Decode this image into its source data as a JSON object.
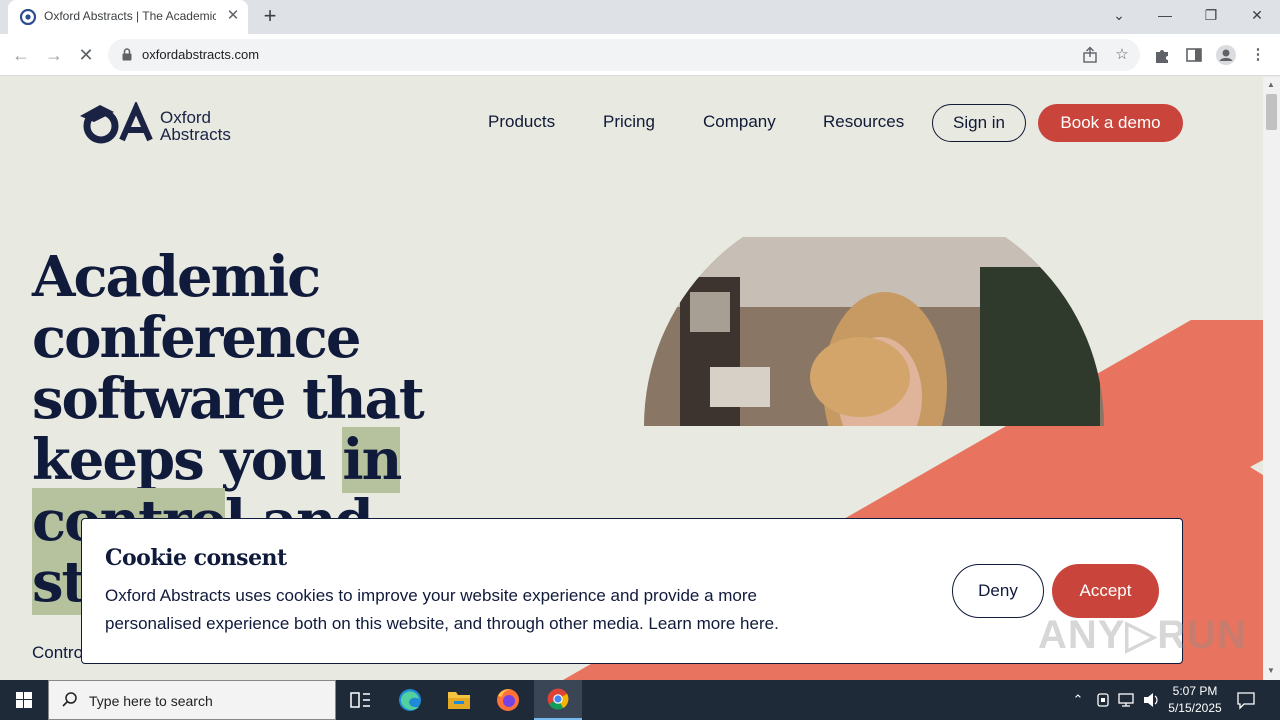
{
  "browser": {
    "tab_title": "Oxford Abstracts | The Academic",
    "tab_close": "✕",
    "new_tab": "+",
    "url": "oxfordabstracts.com",
    "window_controls": {
      "menu": "⌄",
      "minimize": "—",
      "restore": "❐",
      "close": "✕"
    },
    "toolbar_icons": {
      "share": "share-icon",
      "bookmark": "☆",
      "extensions": "puzzle-icon",
      "sidepanel": "sidepanel-icon",
      "profile": "profile-icon",
      "menu": "⋮"
    }
  },
  "site": {
    "logo_text": [
      "Oxford",
      "Abstracts"
    ],
    "nav": [
      "Products",
      "Pricing",
      "Company",
      "Resources"
    ],
    "signin_label": "Sign in",
    "demo_label": "Book a demo",
    "hero_lines": [
      "Academic",
      "conference",
      "software that",
      "keeps you ",
      "in",
      "contro",
      "l and",
      "st"
    ],
    "subtext": "Contro",
    "brand_colors": {
      "navy": "#101a3b",
      "accent": "#c9443b",
      "coral": "#e8735f",
      "highlight": "#b6c29e",
      "background": "#e8e9e1"
    }
  },
  "cookie": {
    "title": "Cookie consent",
    "body": "Oxford Abstracts uses cookies to improve your website experience and provide a more personalised experience both on this website, and through other media. Learn more here.",
    "deny_label": "Deny",
    "accept_label": "Accept"
  },
  "watermark": "ANY▷RUN",
  "taskbar": {
    "search_placeholder": "Type here to search",
    "time": "5:07 PM",
    "date": "5/15/2025",
    "apps": [
      "task-view-icon",
      "edge-icon",
      "file-explorer-icon",
      "firefox-icon",
      "chrome-icon"
    ]
  }
}
